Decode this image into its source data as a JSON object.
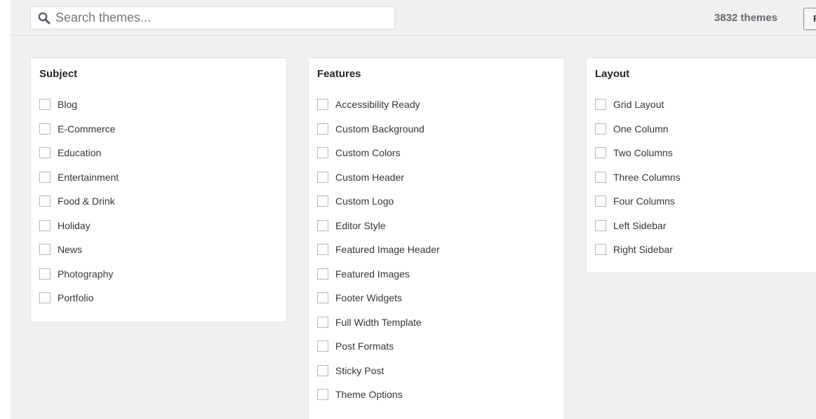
{
  "search": {
    "placeholder": "Search themes..."
  },
  "theme_count": "3832 themes",
  "edge_button_label": "F",
  "icons": {
    "search": "search-icon"
  },
  "colors": {
    "background": "#f0f0f0",
    "panel": "#ffffff",
    "text": "#23282d",
    "muted": "#646970"
  },
  "panels": {
    "subject": {
      "title": "Subject",
      "options": [
        "Blog",
        "E-Commerce",
        "Education",
        "Entertainment",
        "Food & Drink",
        "Holiday",
        "News",
        "Photography",
        "Portfolio"
      ]
    },
    "features": {
      "title": "Features",
      "options": [
        "Accessibility Ready",
        "Custom Background",
        "Custom Colors",
        "Custom Header",
        "Custom Logo",
        "Editor Style",
        "Featured Image Header",
        "Featured Images",
        "Footer Widgets",
        "Full Width Template",
        "Post Formats",
        "Sticky Post",
        "Theme Options"
      ]
    },
    "layout": {
      "title": "Layout",
      "options": [
        "Grid Layout",
        "One Column",
        "Two Columns",
        "Three Columns",
        "Four Columns",
        "Left Sidebar",
        "Right Sidebar"
      ]
    }
  }
}
